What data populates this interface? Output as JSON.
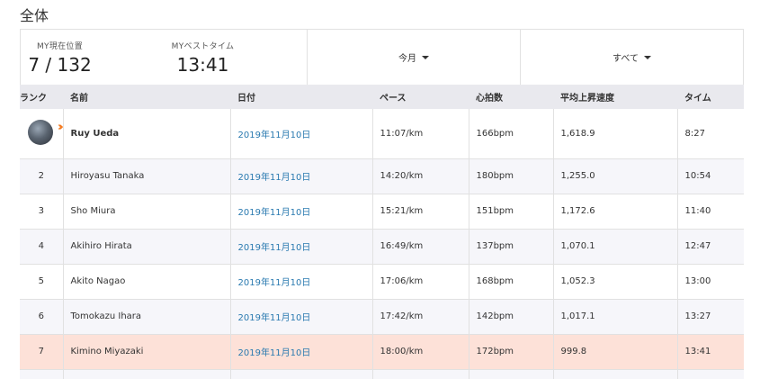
{
  "section_title": "全体",
  "summary": {
    "position_label": "MY現在位置",
    "position_value": "7 / 132",
    "best_label": "MYベストタイム",
    "best_value": "13:41",
    "period_dropdown": "今月",
    "filter_dropdown": "すべて"
  },
  "table": {
    "headers": {
      "rank": "ランク",
      "name": "名前",
      "date": "日付",
      "pace": "ペース",
      "heart": "心拍数",
      "ascent": "平均上昇速度",
      "time": "タイム"
    },
    "rows": [
      {
        "rank": "",
        "name": "Ruy Ueda",
        "date": "2019年11月10日",
        "pace": "11:07/km",
        "heart": "166bpm",
        "ascent": "1,618.9",
        "time": "8:27"
      },
      {
        "rank": "2",
        "name": "Hiroyasu Tanaka",
        "date": "2019年11月10日",
        "pace": "14:20/km",
        "heart": "180bpm",
        "ascent": "1,255.0",
        "time": "10:54"
      },
      {
        "rank": "3",
        "name": "Sho Miura",
        "date": "2019年11月10日",
        "pace": "15:21/km",
        "heart": "151bpm",
        "ascent": "1,172.6",
        "time": "11:40"
      },
      {
        "rank": "4",
        "name": "Akihiro Hirata",
        "date": "2019年11月10日",
        "pace": "16:49/km",
        "heart": "137bpm",
        "ascent": "1,070.1",
        "time": "12:47"
      },
      {
        "rank": "5",
        "name": "Akito Nagao",
        "date": "2019年11月10日",
        "pace": "17:06/km",
        "heart": "168bpm",
        "ascent": "1,052.3",
        "time": "13:00"
      },
      {
        "rank": "6",
        "name": "Tomokazu Ihara",
        "date": "2019年11月10日",
        "pace": "17:42/km",
        "heart": "142bpm",
        "ascent": "1,017.1",
        "time": "13:27"
      },
      {
        "rank": "7",
        "name": "Kimino Miyazaki",
        "date": "2019年11月10日",
        "pace": "18:00/km",
        "heart": "172bpm",
        "ascent": "999.8",
        "time": "13:41"
      }
    ]
  },
  "colors": {
    "link": "#2a7ab0",
    "highlight_row": "#fde1d8",
    "header_bg": "#e9e9ee",
    "medal_accent": "#f47a1f"
  },
  "icons": {
    "avatar": "user-avatar",
    "first_place": "double-chevron-icon",
    "dropdown": "caret-down-icon"
  }
}
